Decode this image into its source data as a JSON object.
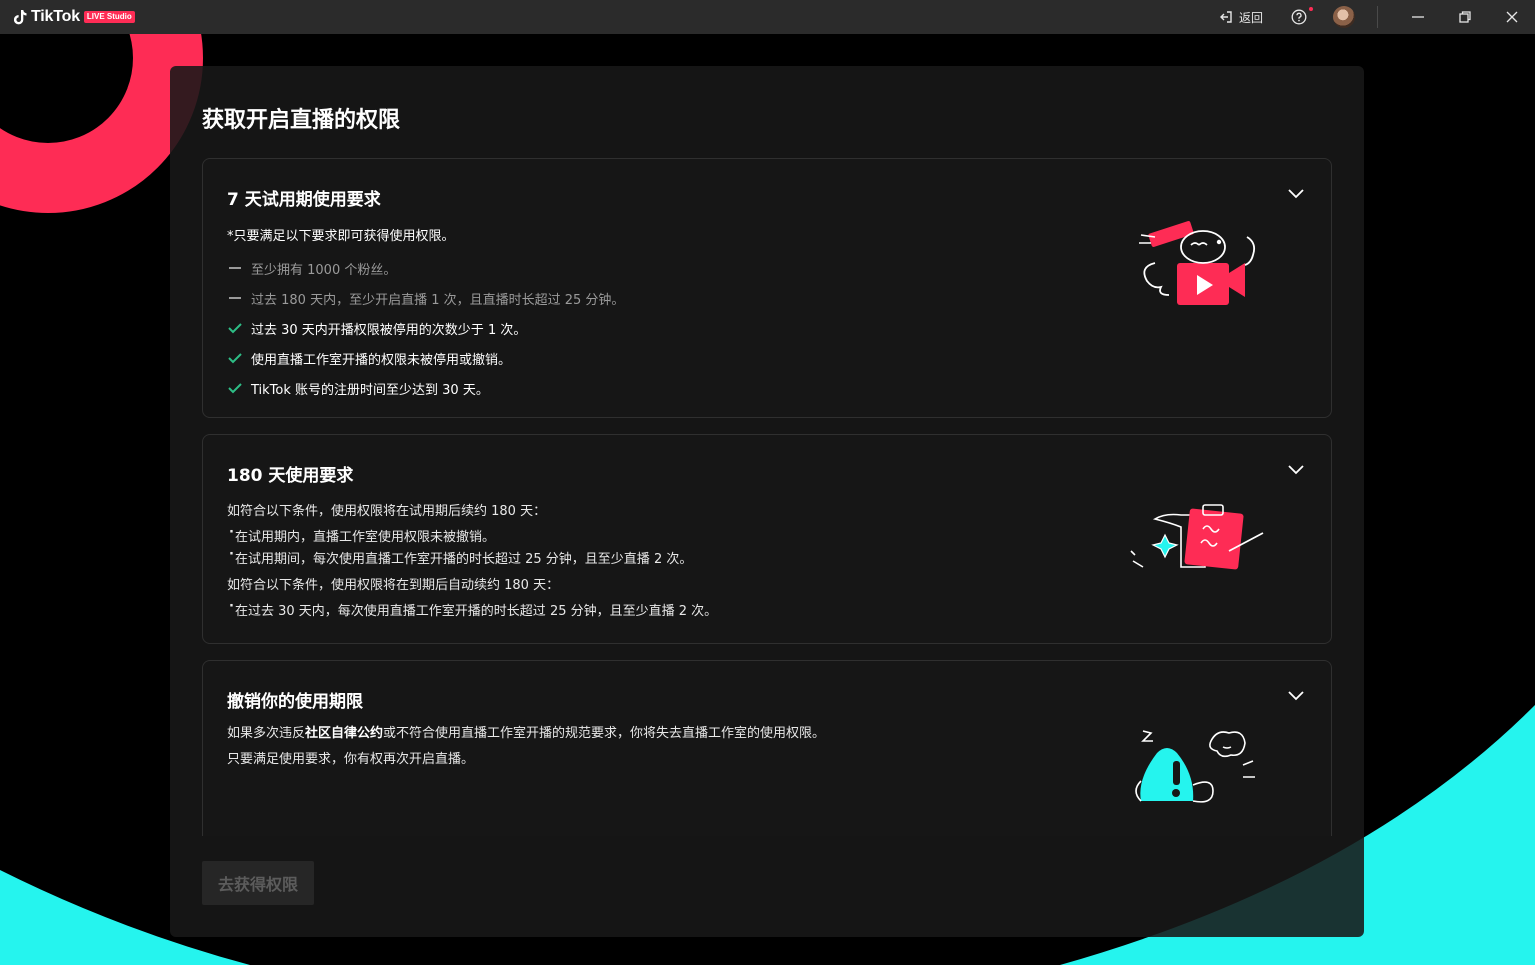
{
  "app": {
    "brand_name": "TikTok",
    "brand_badge": "LIVE Studio"
  },
  "titlebar": {
    "back_label": "返回"
  },
  "page": {
    "title": "获取开启直播的权限"
  },
  "card_trial": {
    "title": "7 天试用期使用要求",
    "intro": "*只要满足以下要求即可获得使用权限。",
    "items": [
      {
        "status": "unmet",
        "text": "至少拥有 1000 个粉丝。"
      },
      {
        "status": "unmet",
        "text": "过去 180 天内，至少开启直播 1 次，且直播时长超过 25 分钟。"
      },
      {
        "status": "met",
        "text": "过去 30 天内开播权限被停用的次数少于 1 次。"
      },
      {
        "status": "met",
        "text": "使用直播工作室开播的权限未被停用或撤销。"
      },
      {
        "status": "met",
        "text": "TikTok 账号的注册时间至少达到 30 天。"
      }
    ]
  },
  "card_180": {
    "title": "180 天使用要求",
    "para1": "如符合以下条件，使用权限将在试用期后续约 180 天：",
    "bullets1": [
      "在试用期内，直播工作室使用权限未被撤销。",
      "在试用期间，每次使用直播工作室开播的时长超过 25 分钟，且至少直播 2 次。"
    ],
    "para2": "如符合以下条件，使用权限将在到期后自动续约 180 天：",
    "bullets2": [
      "在过去 30 天内，每次使用直播工作室开播的时长超过 25 分钟，且至少直播 2 次。"
    ]
  },
  "card_revoke": {
    "title": "撤销你的使用期限",
    "line1_pre": "如果多次违反",
    "line1_link": "社区自律公约",
    "line1_post": "或不符合使用直播工作室开播的规范要求，你将失去直播工作室的使用权限。",
    "line2": "只要满足使用要求，你有权再次开启直播。"
  },
  "actions": {
    "go_button": "去获得权限"
  },
  "colors": {
    "brand_pink": "#fe2c55",
    "brand_cyan": "#25f4ee",
    "check_green": "#2ebd85",
    "panel_bg": "#181818"
  },
  "icons": [
    "tiktok-logo-icon",
    "back-icon",
    "help-icon",
    "avatar",
    "minimize-icon",
    "restore-icon",
    "close-icon",
    "chevron-down-icon",
    "check-icon",
    "dash-icon"
  ]
}
